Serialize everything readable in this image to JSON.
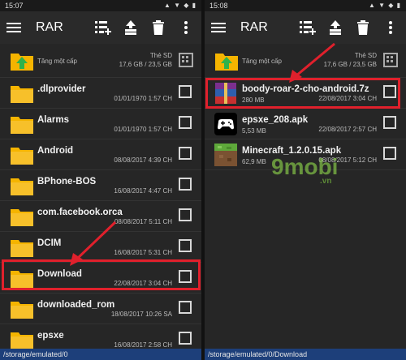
{
  "left": {
    "status": {
      "time": "15:07"
    },
    "toolbar": {
      "title": "RAR"
    },
    "parent": {
      "label": "Tăng một cấp",
      "sd_label": "Thẻ SD",
      "storage": "17,6 GB / 23,5 GB"
    },
    "items": [
      {
        "name": ".dlprovider",
        "date": "01/01/1970 1:57 CH"
      },
      {
        "name": "Alarms",
        "date": "01/01/1970 1:57 CH"
      },
      {
        "name": "Android",
        "date": "08/08/2017 4:39 CH"
      },
      {
        "name": "BPhone-BOS",
        "date": "16/08/2017 4:47 CH"
      },
      {
        "name": "com.facebook.orca",
        "date": "08/08/2017 5:11 CH"
      },
      {
        "name": "DCIM",
        "date": "16/08/2017 5:31 CH"
      },
      {
        "name": "Download",
        "date": "22/08/2017 3:04 CH"
      },
      {
        "name": "downloaded_rom",
        "date": "18/08/2017 10:26 SA"
      },
      {
        "name": "epsxe",
        "date": "16/08/2017 2:58 CH"
      }
    ],
    "path": "/storage/emulated/0"
  },
  "right": {
    "status": {
      "time": "15:08"
    },
    "toolbar": {
      "title": "RAR"
    },
    "parent": {
      "label": "Tăng một cấp",
      "sd_label": "Thẻ SD",
      "storage": "17,6 GB / 23,5 GB"
    },
    "items": [
      {
        "name": "boody-roar-2-cho-android.7z",
        "size": "280 MB",
        "date": "22/08/2017 3:04 CH",
        "type": "archive"
      },
      {
        "name": "epsxe_208.apk",
        "size": "5,53 MB",
        "date": "22/08/2017 2:57 CH",
        "type": "gamepad"
      },
      {
        "name": "Minecraft_1.2.0.15.apk",
        "size": "62,9 MB",
        "date": "08/08/2017 5:12 CH",
        "type": "minecraft"
      }
    ],
    "path": "/storage/emulated/0/Download"
  },
  "watermark": {
    "main": "9mobi",
    "suffix": ".vn"
  },
  "colors": {
    "highlight": "#e0202c",
    "folder": "#f5b400",
    "path_bar": "#1d3f7a"
  }
}
